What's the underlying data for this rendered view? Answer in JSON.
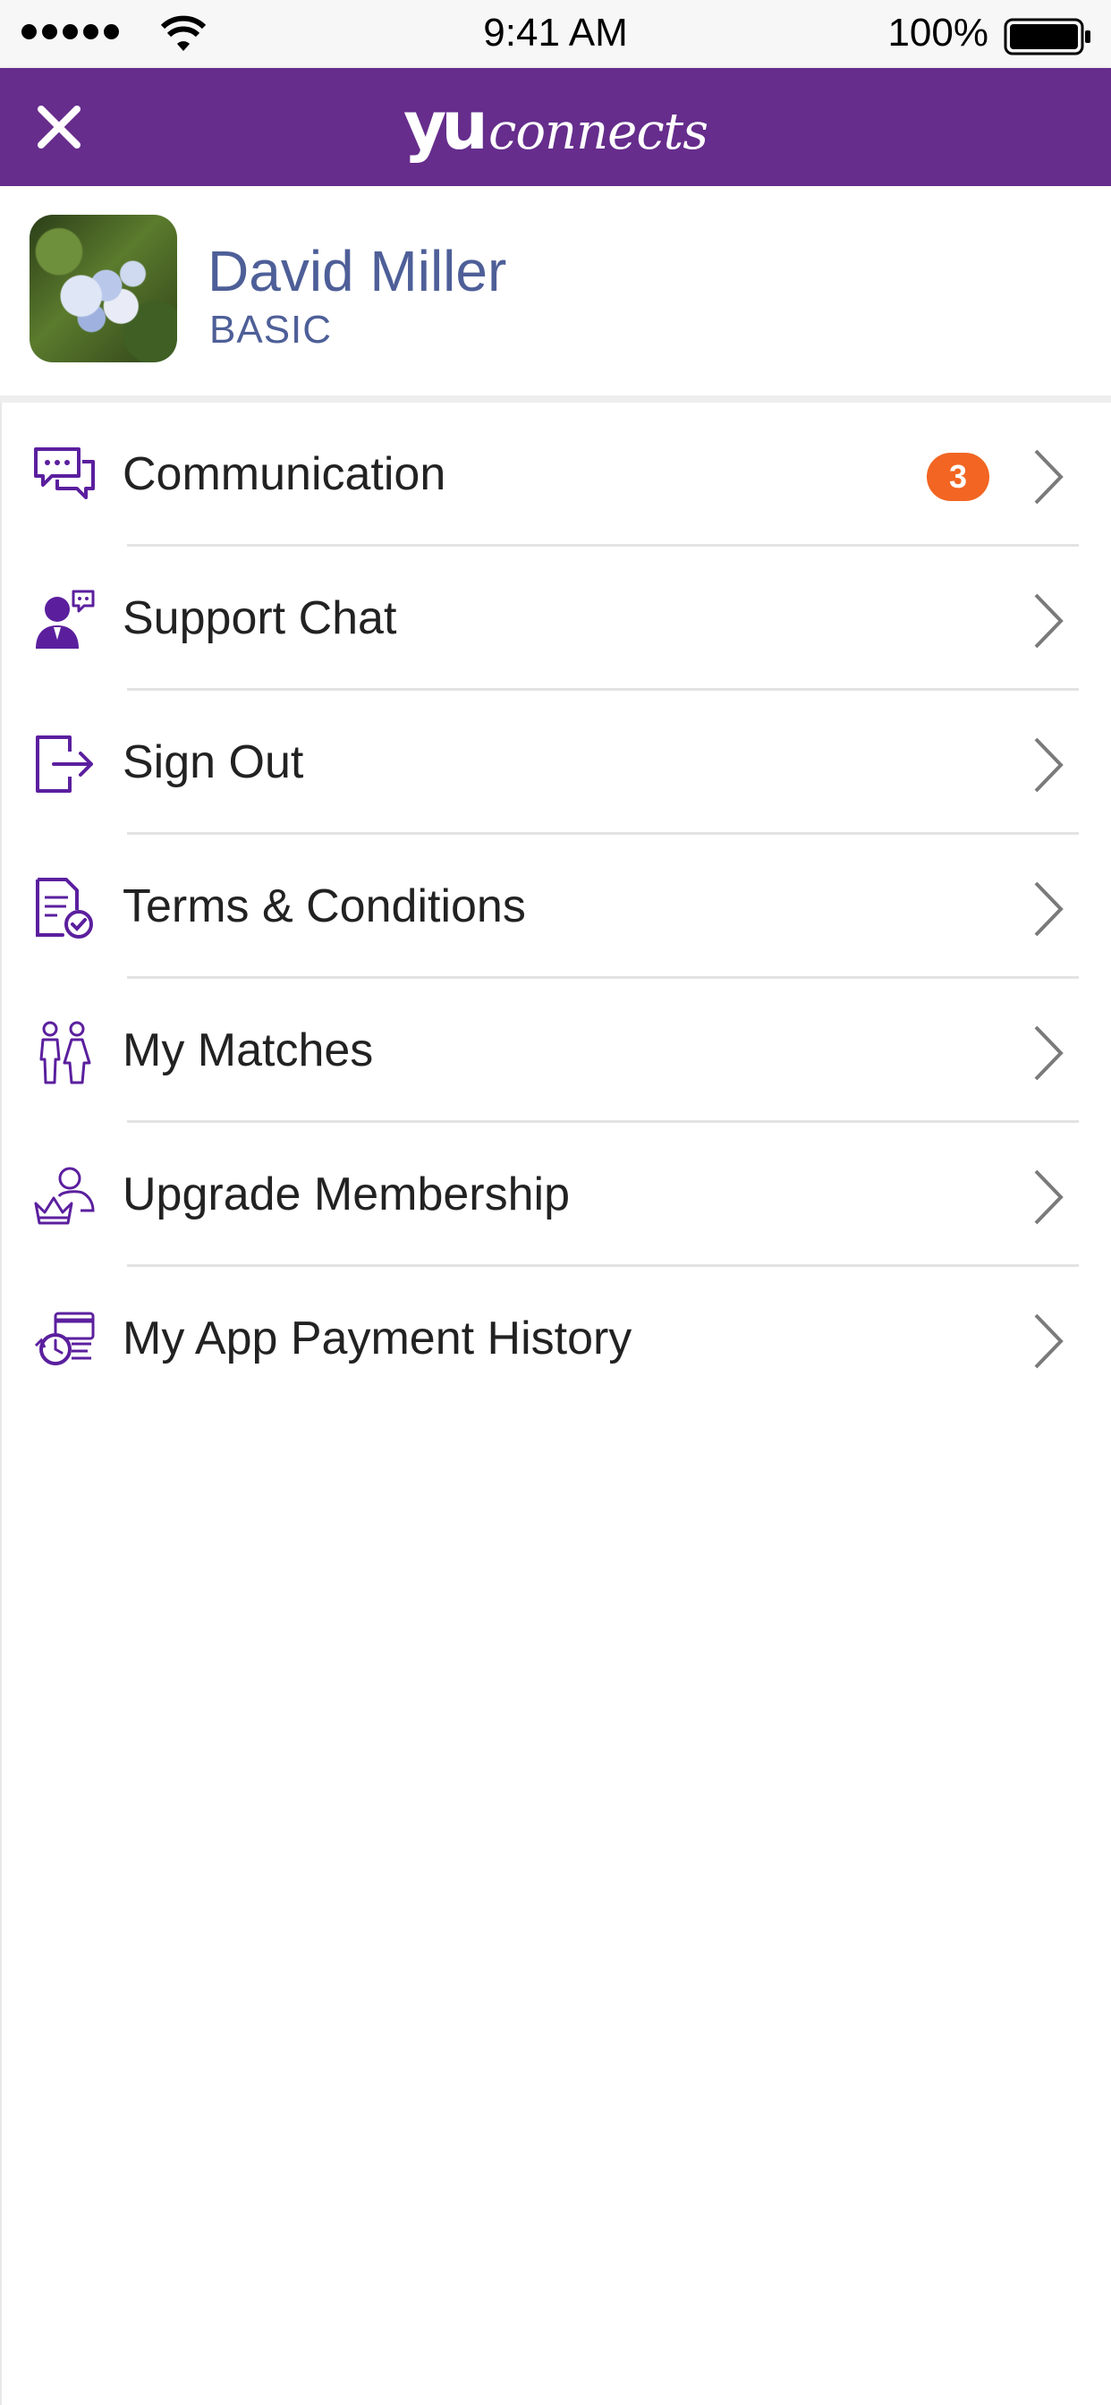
{
  "status_bar": {
    "time": "9:41 AM",
    "battery_percent": "100%"
  },
  "app_bar": {
    "logo_primary": "yu",
    "logo_secondary": "connects",
    "close_icon": "close-icon"
  },
  "profile": {
    "name": "David Miller",
    "plan": "BASIC"
  },
  "menu": {
    "items": [
      {
        "label": "Communication",
        "icon": "chat-bubbles-icon",
        "badge": "3"
      },
      {
        "label": "Support Chat",
        "icon": "support-agent-icon"
      },
      {
        "label": "Sign Out",
        "icon": "sign-out-icon"
      },
      {
        "label": "Terms & Conditions",
        "icon": "document-check-icon"
      },
      {
        "label": "My Matches",
        "icon": "couple-icon"
      },
      {
        "label": "Upgrade Membership",
        "icon": "crown-user-icon"
      },
      {
        "label": "My App Payment History",
        "icon": "payment-history-icon"
      }
    ]
  },
  "colors": {
    "brand_purple": "#662d8c",
    "icon_purple": "#5b1f9e",
    "badge_orange": "#f26522",
    "profile_text": "#4e5f98"
  }
}
